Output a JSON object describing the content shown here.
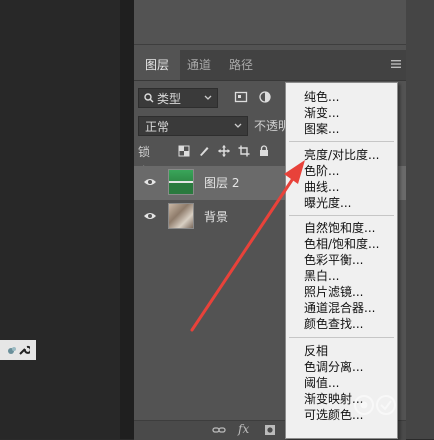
{
  "panel": {
    "tabs": [
      {
        "label": "图层",
        "active": true
      },
      {
        "label": "通道",
        "active": false
      },
      {
        "label": "路径",
        "active": false
      }
    ],
    "filter_kind": "类型",
    "blend_mode": "正常",
    "opacity_label": "不透明",
    "lock_label": "锁定:"
  },
  "layers": [
    {
      "name": "图层 2",
      "selected": true,
      "thumbnail": "green-grass"
    },
    {
      "name": "背景",
      "selected": false,
      "thumbnail": "photo"
    }
  ],
  "bottom_bar": {
    "fx_label": "fx"
  },
  "adjustment_menu": {
    "groups": [
      [
        "纯色...",
        "渐变...",
        "图案..."
      ],
      [
        "亮度/对比度...",
        "色阶...",
        "曲线...",
        "曝光度..."
      ],
      [
        "自然饱和度...",
        "色相/饱和度...",
        "色彩平衡...",
        "黑白...",
        "照片滤镜...",
        "通道混合器...",
        "颜色查找..."
      ],
      [
        "反相",
        "色调分离...",
        "阈值...",
        "渐变映射...",
        "可选颜色..."
      ]
    ]
  },
  "colors": {
    "panel_bg": "#535353",
    "menu_bg": "#f0f0f0",
    "arrow": "#e8423a"
  }
}
